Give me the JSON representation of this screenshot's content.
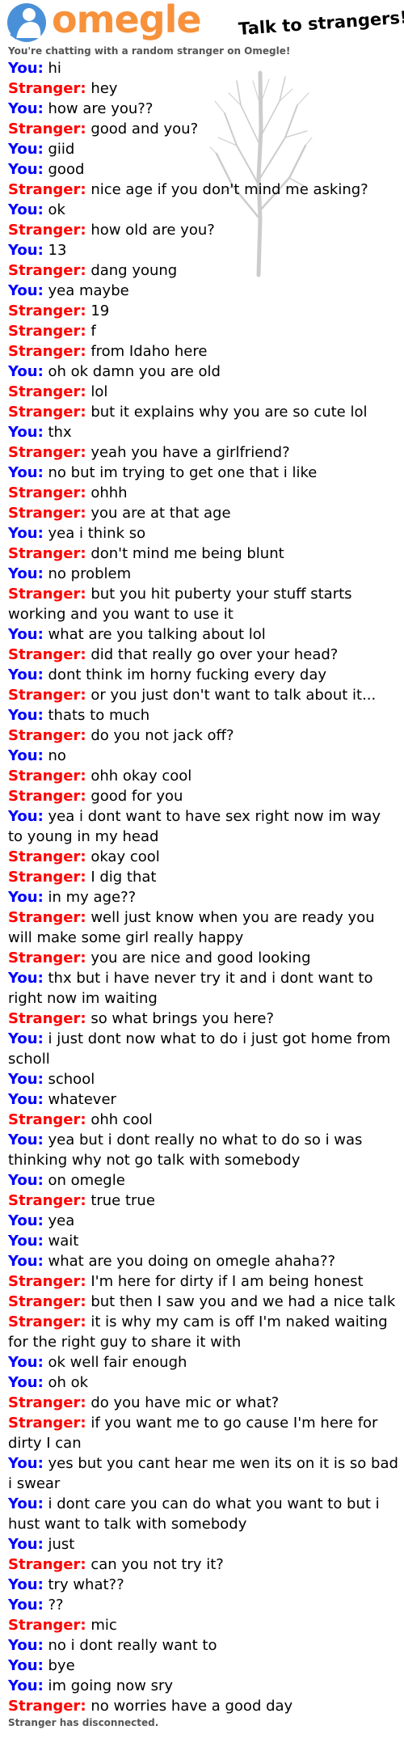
{
  "header": {
    "logo_text": "omegle",
    "tagline": "Talk to strangers!",
    "logo_icon": "omegle-person-icon",
    "brand_color": "#f7913b",
    "icon_color": "#4a90d9"
  },
  "intro": "You're chatting with a random stranger on Omegle!",
  "colors": {
    "you": "#0000ff",
    "stranger": "#ff0000"
  },
  "messages": [
    {
      "who": "You:",
      "text": "hi"
    },
    {
      "who": "Stranger:",
      "text": "hey"
    },
    {
      "who": "You:",
      "text": "how are you??"
    },
    {
      "who": "Stranger:",
      "text": "good and you?"
    },
    {
      "who": "You:",
      "text": "giid"
    },
    {
      "who": "You:",
      "text": "good"
    },
    {
      "who": "Stranger:",
      "text": "nice age if you don't mind me asking?"
    },
    {
      "who": "You:",
      "text": "ok"
    },
    {
      "who": "Stranger:",
      "text": "how old are you?"
    },
    {
      "who": "You:",
      "text": "13"
    },
    {
      "who": "Stranger:",
      "text": "dang young"
    },
    {
      "who": "You:",
      "text": "yea maybe"
    },
    {
      "who": "Stranger:",
      "text": "19"
    },
    {
      "who": "Stranger:",
      "text": "f"
    },
    {
      "who": "Stranger:",
      "text": "from Idaho here"
    },
    {
      "who": "You:",
      "text": "oh ok damn you are old"
    },
    {
      "who": "Stranger:",
      "text": "lol"
    },
    {
      "who": "Stranger:",
      "text": "but it explains why you are so cute lol"
    },
    {
      "who": "You:",
      "text": "thx"
    },
    {
      "who": "Stranger:",
      "text": "yeah you have a girlfriend?"
    },
    {
      "who": "You:",
      "text": "no but im trying to get one that i like"
    },
    {
      "who": "Stranger:",
      "text": "ohhh"
    },
    {
      "who": "Stranger:",
      "text": "you are at that age"
    },
    {
      "who": "You:",
      "text": "yea i think so"
    },
    {
      "who": "Stranger:",
      "text": "don't mind me being blunt"
    },
    {
      "who": "You:",
      "text": "no problem"
    },
    {
      "who": "Stranger:",
      "text": "but you hit puberty your stuff starts working and you want to use it"
    },
    {
      "who": "You:",
      "text": "what are you talking about lol"
    },
    {
      "who": "Stranger:",
      "text": "did that really go over your head?"
    },
    {
      "who": "You:",
      "text": "dont think im horny fucking every day"
    },
    {
      "who": "Stranger:",
      "text": "or you just don't want to talk about it..."
    },
    {
      "who": "You:",
      "text": "thats to much"
    },
    {
      "who": "Stranger:",
      "text": "do you not jack off?"
    },
    {
      "who": "You:",
      "text": "no"
    },
    {
      "who": "Stranger:",
      "text": "ohh okay cool"
    },
    {
      "who": "Stranger:",
      "text": "good for you"
    },
    {
      "who": "You:",
      "text": "yea i dont want to have sex right now im way to young in my head"
    },
    {
      "who": "Stranger:",
      "text": "okay cool"
    },
    {
      "who": "Stranger:",
      "text": "I dig that"
    },
    {
      "who": "You:",
      "text": "in my age??"
    },
    {
      "who": "Stranger:",
      "text": "well just know when you are ready you will make some girl really happy"
    },
    {
      "who": "Stranger:",
      "text": "you are nice and good looking"
    },
    {
      "who": "You:",
      "text": "thx but i have never try it and i dont want to right now im waiting"
    },
    {
      "who": "Stranger:",
      "text": "so what brings you here?"
    },
    {
      "who": "You:",
      "text": "i just dont now what to do i just got home from scholl"
    },
    {
      "who": "You:",
      "text": "school"
    },
    {
      "who": "You:",
      "text": "whatever"
    },
    {
      "who": "Stranger:",
      "text": "ohh cool"
    },
    {
      "who": "You:",
      "text": "yea but i dont really no what to do so i was thinking why not go talk with somebody"
    },
    {
      "who": "You:",
      "text": "on omegle"
    },
    {
      "who": "Stranger:",
      "text": "true true"
    },
    {
      "who": "You:",
      "text": "yea"
    },
    {
      "who": "You:",
      "text": "wait"
    },
    {
      "who": "You:",
      "text": "what are you doing on omegle ahaha??"
    },
    {
      "who": "Stranger:",
      "text": "I'm here for dirty if I am being honest"
    },
    {
      "who": "Stranger:",
      "text": "but then I saw you and we had a nice talk"
    },
    {
      "who": "Stranger:",
      "text": "it is why my cam is off I'm naked waiting for the right guy to share it with"
    },
    {
      "who": "You:",
      "text": "ok well fair enough"
    },
    {
      "who": "You:",
      "text": "oh ok"
    },
    {
      "who": "Stranger:",
      "text": "do you have mic or what?"
    },
    {
      "who": "Stranger:",
      "text": "if you want me to go cause I'm here for dirty I can"
    },
    {
      "who": "You:",
      "text": "yes but you cant hear me wen its on it is so bad i swear"
    },
    {
      "who": "You:",
      "text": "i dont care you can do what you want to but i hust want to talk with somebody"
    },
    {
      "who": "You:",
      "text": "just"
    },
    {
      "who": "Stranger:",
      "text": "can you not try it?"
    },
    {
      "who": "You:",
      "text": "try what??"
    },
    {
      "who": "You:",
      "text": "??"
    },
    {
      "who": "Stranger:",
      "text": "mic"
    },
    {
      "who": "You:",
      "text": "no i dont really want to"
    },
    {
      "who": "You:",
      "text": "bye"
    },
    {
      "who": "You:",
      "text": "im going now sry"
    },
    {
      "who": "Stranger:",
      "text": "no worries have a good day"
    }
  ],
  "status": "Stranger has disconnected."
}
